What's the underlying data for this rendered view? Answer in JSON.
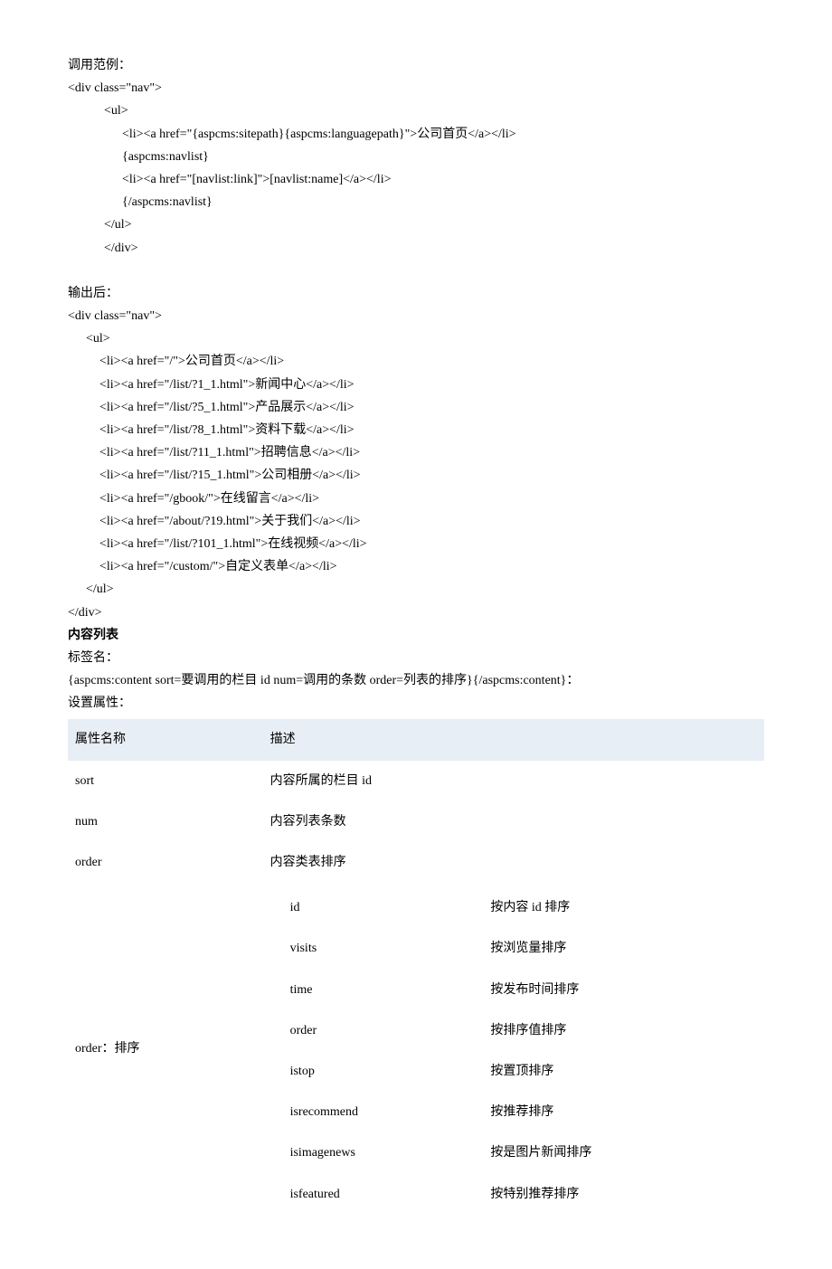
{
  "section1": {
    "title": "调用范例：",
    "lines": [
      "<div class=\"nav\">",
      "<ul>",
      "<li><a href=\"{aspcms:sitepath}{aspcms:languagepath}\">公司首页</a></li>",
      "{aspcms:navlist}",
      "<li><a href=\"[navlist:link]\">[navlist:name]</a></li>",
      "{/aspcms:navlist}",
      "</ul>",
      "</div>"
    ]
  },
  "section2": {
    "title": "输出后：",
    "lines": [
      "<div class=\"nav\">",
      "<ul>",
      "<li><a href=\"/\">公司首页</a></li>",
      "<li><a href=\"/list/?1_1.html\">新闻中心</a></li>",
      "<li><a href=\"/list/?5_1.html\">产品展示</a></li>",
      "<li><a href=\"/list/?8_1.html\">资料下载</a></li>",
      "<li><a href=\"/list/?11_1.html\">招聘信息</a></li>",
      "<li><a href=\"/list/?15_1.html\">公司相册</a></li>",
      "<li><a href=\"/gbook/\">在线留言</a></li>",
      "<li><a href=\"/about/?19.html\">关于我们</a></li>",
      "<li><a href=\"/list/?101_1.html\">在线视频</a></li>",
      "<li><a href=\"/custom/\">自定义表单</a></li>",
      "</ul>",
      "</div>"
    ]
  },
  "section3": {
    "heading": "内容列表",
    "tagLabel": "标签名：",
    "tagContent": "{aspcms:content sort=要调用的栏目 id num=调用的条数  order=列表的排序}{/aspcms:content}：",
    "attrLabel": "设置属性："
  },
  "table": {
    "headers": {
      "col1": "属性名称",
      "col2": "描述"
    },
    "rows": [
      {
        "name": "sort",
        "desc": "内容所属的栏目 id"
      },
      {
        "name": "num",
        "desc": "内容列表条数"
      },
      {
        "name": "order",
        "desc": "内容类表排序"
      }
    ],
    "orderRow": {
      "label": "order：排序",
      "values": [
        {
          "key": "id",
          "desc": "按内容 id 排序"
        },
        {
          "key": "visits",
          "desc": "按浏览量排序"
        },
        {
          "key": "time",
          "desc": "按发布时间排序"
        },
        {
          "key": "order",
          "desc": "按排序值排序"
        },
        {
          "key": "istop",
          "desc": "按置顶排序"
        },
        {
          "key": "isrecommend",
          "desc": "按推荐排序"
        },
        {
          "key": "isimagenews",
          "desc": "按是图片新闻排序"
        },
        {
          "key": "isfeatured",
          "desc": "按特别推荐排序"
        }
      ]
    }
  }
}
